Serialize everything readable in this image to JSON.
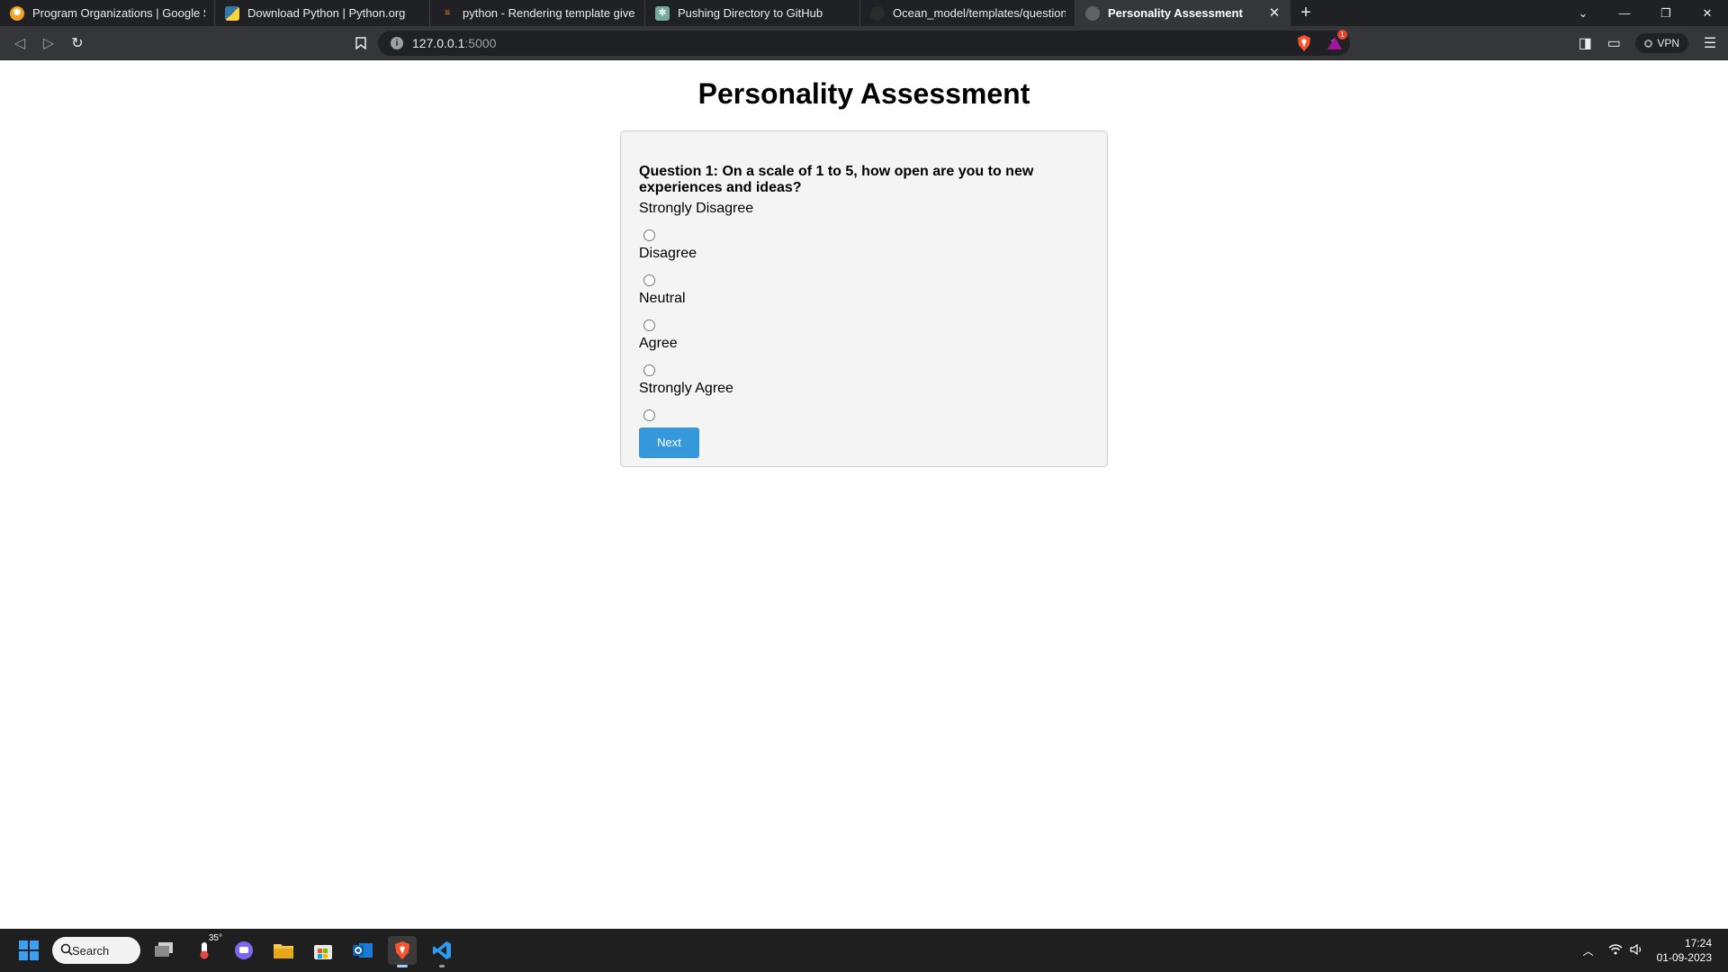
{
  "browser": {
    "tabs": [
      {
        "title": "Program Organizations | Google Summ",
        "icon": "google-summer-of-code-icon",
        "active": false
      },
      {
        "title": "Download Python | Python.org",
        "icon": "python-icon",
        "active": false
      },
      {
        "title": "python - Rendering template gives \"jin",
        "icon": "stackoverflow-icon",
        "active": false
      },
      {
        "title": "Pushing Directory to GitHub",
        "icon": "chatgpt-icon",
        "active": false
      },
      {
        "title": "Ocean_model/templates/questions.htm",
        "icon": "github-icon",
        "active": false
      },
      {
        "title": "Personality Assessment",
        "icon": "globe-icon",
        "active": true
      }
    ],
    "url_host": "127.0.0.1",
    "url_port": ":5000",
    "vpn_label": "VPN",
    "brave_badge": "1"
  },
  "page": {
    "title": "Personality Assessment",
    "question": "Question 1: On a scale of 1 to 5, how open are you to new experiences and ideas?",
    "options": [
      "Strongly Disagree",
      "Disagree",
      "Neutral",
      "Agree",
      "Strongly Agree"
    ],
    "next_label": "Next"
  },
  "taskbar": {
    "search_label": "Search",
    "weather_temp": "35°",
    "time": "17:24",
    "date": "01-09-2023"
  },
  "colors": {
    "accent": "#3498db",
    "card_bg": "#f4f4f4",
    "tab_strip": "#202124",
    "toolbar": "#35363a"
  }
}
